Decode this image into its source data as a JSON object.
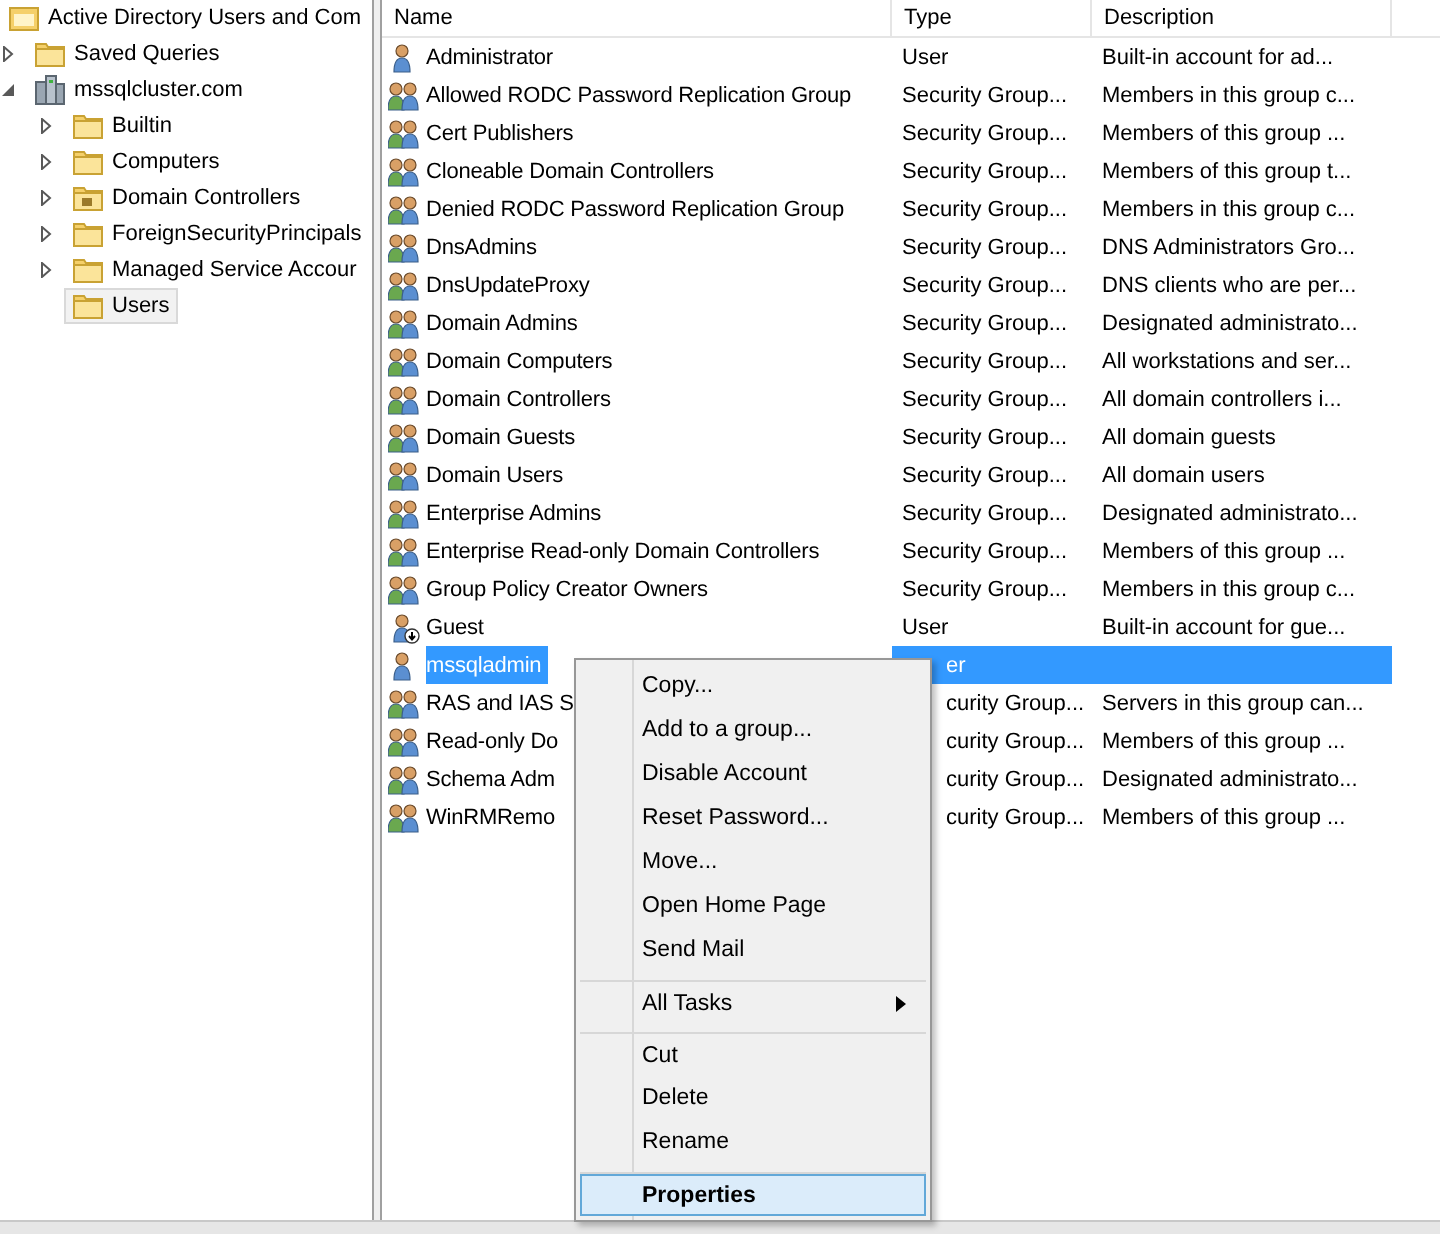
{
  "tree": [
    {
      "label": "Active Directory Users and Com",
      "kind": "root",
      "selected": false,
      "children": [
        {
          "label": "Saved Queries",
          "kind": "folder",
          "expanded": false,
          "selected": false
        },
        {
          "label": "mssqlcluster.com",
          "kind": "domain",
          "expanded": true,
          "selected": false,
          "children": [
            {
              "label": "Builtin",
              "kind": "folder",
              "expanded": false,
              "selected": false
            },
            {
              "label": "Computers",
              "kind": "folder",
              "expanded": false,
              "selected": false
            },
            {
              "label": "Domain Controllers",
              "kind": "ou",
              "expanded": false,
              "selected": false
            },
            {
              "label": "ForeignSecurityPrincipals",
              "kind": "folder",
              "expanded": false,
              "selected": false
            },
            {
              "label": "Managed Service Accour",
              "kind": "folder",
              "expanded": false,
              "selected": false
            },
            {
              "label": "Users",
              "kind": "folder",
              "selected": true
            }
          ]
        }
      ]
    }
  ],
  "table": {
    "columns": [
      "Name",
      "Type",
      "Description"
    ],
    "rows": [
      {
        "name": "Administrator",
        "kind": "user",
        "type": "User",
        "description": "Built-in account for ad...",
        "selected": false,
        "disabled": false
      },
      {
        "name": "Allowed RODC Password Replication Group",
        "kind": "group",
        "type": "Security Group...",
        "description": "Members in this group c...",
        "selected": false,
        "disabled": false
      },
      {
        "name": "Cert Publishers",
        "kind": "group",
        "type": "Security Group...",
        "description": "Members of this group ...",
        "selected": false,
        "disabled": false
      },
      {
        "name": "Cloneable Domain Controllers",
        "kind": "group",
        "type": "Security Group...",
        "description": "Members of this group t...",
        "selected": false,
        "disabled": false
      },
      {
        "name": "Denied RODC Password Replication Group",
        "kind": "group",
        "type": "Security Group...",
        "description": "Members in this group c...",
        "selected": false,
        "disabled": false
      },
      {
        "name": "DnsAdmins",
        "kind": "group",
        "type": "Security Group...",
        "description": "DNS Administrators Gro...",
        "selected": false,
        "disabled": false
      },
      {
        "name": "DnsUpdateProxy",
        "kind": "group",
        "type": "Security Group...",
        "description": "DNS clients who are per...",
        "selected": false,
        "disabled": false
      },
      {
        "name": "Domain Admins",
        "kind": "group",
        "type": "Security Group...",
        "description": "Designated administrato...",
        "selected": false,
        "disabled": false
      },
      {
        "name": "Domain Computers",
        "kind": "group",
        "type": "Security Group...",
        "description": "All workstations and ser...",
        "selected": false,
        "disabled": false
      },
      {
        "name": "Domain Controllers",
        "kind": "group",
        "type": "Security Group...",
        "description": "All domain controllers i...",
        "selected": false,
        "disabled": false
      },
      {
        "name": "Domain Guests",
        "kind": "group",
        "type": "Security Group...",
        "description": "All domain guests",
        "selected": false,
        "disabled": false
      },
      {
        "name": "Domain Users",
        "kind": "group",
        "type": "Security Group...",
        "description": "All domain users",
        "selected": false,
        "disabled": false
      },
      {
        "name": "Enterprise Admins",
        "kind": "group",
        "type": "Security Group...",
        "description": "Designated administrato...",
        "selected": false,
        "disabled": false
      },
      {
        "name": "Enterprise Read-only Domain Controllers",
        "kind": "group",
        "type": "Security Group...",
        "description": "Members of this group ...",
        "selected": false,
        "disabled": false
      },
      {
        "name": "Group Policy Creator Owners",
        "kind": "group",
        "type": "Security Group...",
        "description": "Members in this group c...",
        "selected": false,
        "disabled": false
      },
      {
        "name": "Guest",
        "kind": "user",
        "type": "User",
        "description": "Built-in account for gue...",
        "selected": false,
        "disabled": true
      },
      {
        "name": "mssqladmin",
        "kind": "user",
        "type": "er",
        "covered": true,
        "selected": true,
        "disabled": false
      },
      {
        "name": "RAS and IAS S",
        "kind": "group",
        "type": "curity Group...",
        "covered": true,
        "description": "Servers in this group can...",
        "selected": false,
        "disabled": false
      },
      {
        "name": "Read-only Do",
        "kind": "group",
        "type": "curity Group...",
        "covered": true,
        "description": "Members of this group ...",
        "selected": false,
        "disabled": false
      },
      {
        "name": "Schema Adm",
        "kind": "group",
        "type": "curity Group...",
        "covered": true,
        "description": "Designated administrato...",
        "selected": false,
        "disabled": false
      },
      {
        "name": "WinRMRemo",
        "kind": "group",
        "type": "curity Group...",
        "covered": true,
        "description": "Members of this group ...",
        "selected": false,
        "disabled": false
      }
    ]
  },
  "context_menu": [
    {
      "label": "Copy...",
      "selected": false
    },
    {
      "label": "Add to a group...",
      "selected": false
    },
    {
      "label": "Disable Account",
      "selected": false
    },
    {
      "label": "Reset Password...",
      "selected": false
    },
    {
      "label": "Move...",
      "selected": false
    },
    {
      "label": "Open Home Page",
      "selected": false
    },
    {
      "label": "Send Mail",
      "selected": false
    },
    {
      "label": "All Tasks",
      "separator_before": true,
      "submenu": true,
      "selected": false
    },
    {
      "label": "Cut",
      "separator_before": true,
      "selected": false
    },
    {
      "label": "Delete",
      "selected": false
    },
    {
      "label": "Rename",
      "selected": false
    },
    {
      "label": "Properties",
      "separator_before": true,
      "default": true,
      "selected": true
    }
  ]
}
